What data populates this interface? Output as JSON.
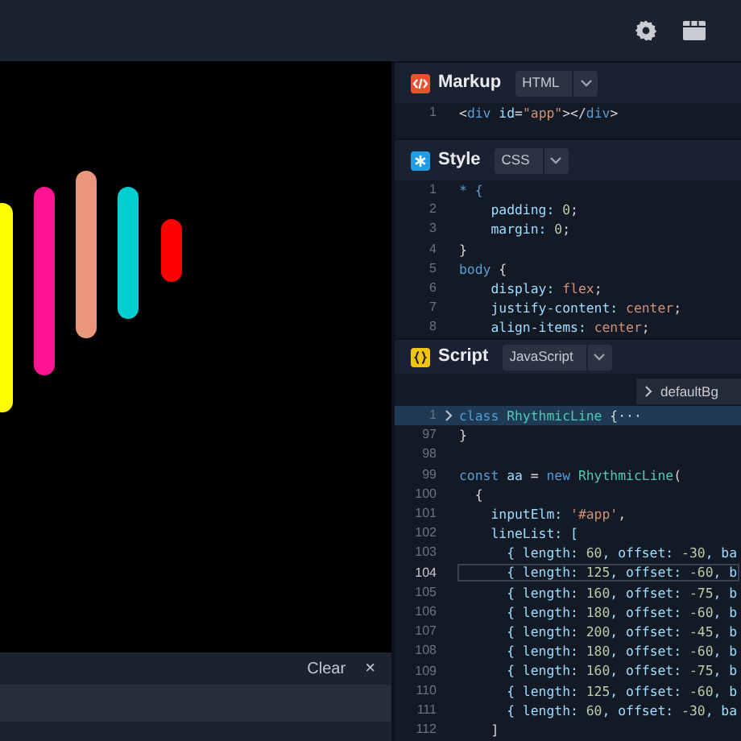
{
  "preview": {
    "bars": [
      {
        "color": "#ffff00"
      },
      {
        "color": "#ff1493"
      },
      {
        "color": "#e9967a"
      },
      {
        "color": "#00ced1"
      },
      {
        "color": "#ff0000"
      }
    ]
  },
  "console": {
    "clear_label": "Clear",
    "close_label": "×"
  },
  "panels": [
    {
      "kind": "markup",
      "title": "Markup",
      "language": "HTML",
      "lines": [
        {
          "n": "1",
          "tokens": [
            {
              "text": "<",
              "kind": "punct"
            },
            {
              "text": "div",
              "kind": "keyword"
            },
            {
              "text": " id",
              "kind": "property"
            },
            {
              "text": "=",
              "kind": "punct"
            },
            {
              "text": "\"app\"",
              "kind": "string"
            },
            {
              "text": "></",
              "kind": "punct"
            },
            {
              "text": "div",
              "kind": "keyword"
            },
            {
              "text": ">",
              "kind": "punct"
            }
          ]
        }
      ]
    },
    {
      "kind": "style",
      "title": "Style",
      "language": "CSS",
      "lines": [
        {
          "n": "1",
          "tokens": [
            {
              "text": "* {",
              "kind": "keyword"
            }
          ]
        },
        {
          "n": "2",
          "tokens": [
            {
              "text": "    padding: ",
              "kind": "property"
            },
            {
              "text": "0",
              "kind": "number"
            },
            {
              "text": ";",
              "kind": "punct"
            }
          ]
        },
        {
          "n": "3",
          "tokens": [
            {
              "text": "    margin: ",
              "kind": "property"
            },
            {
              "text": "0",
              "kind": "number"
            },
            {
              "text": ";",
              "kind": "punct"
            }
          ]
        },
        {
          "n": "4",
          "tokens": [
            {
              "text": "}",
              "kind": "punct"
            }
          ]
        },
        {
          "n": "5",
          "tokens": [
            {
              "text": "body",
              "kind": "keyword"
            },
            {
              "text": " {",
              "kind": "punct"
            }
          ]
        },
        {
          "n": "6",
          "tokens": [
            {
              "text": "    display: ",
              "kind": "property"
            },
            {
              "text": "flex",
              "kind": "string"
            },
            {
              "text": ";",
              "kind": "punct"
            }
          ]
        },
        {
          "n": "7",
          "tokens": [
            {
              "text": "    justify-content: ",
              "kind": "property"
            },
            {
              "text": "center",
              "kind": "string"
            },
            {
              "text": ";",
              "kind": "punct"
            }
          ]
        },
        {
          "n": "8",
          "tokens": [
            {
              "text": "    align-items: ",
              "kind": "property"
            },
            {
              "text": "center",
              "kind": "string"
            },
            {
              "text": ";",
              "kind": "punct"
            }
          ]
        }
      ]
    },
    {
      "kind": "script",
      "title": "Script",
      "language": "JavaScript",
      "breadcrumb": "defaultBg",
      "lines": [
        {
          "n": "1",
          "folded": true,
          "tokens": [
            {
              "text": "class ",
              "kind": "keyword"
            },
            {
              "text": "RhythmicLine",
              "kind": "class"
            },
            {
              "text": " {",
              "kind": "punct"
            },
            {
              "text": "···",
              "kind": "punct"
            }
          ]
        },
        {
          "n": "97",
          "tokens": [
            {
              "text": "}",
              "kind": "punct"
            }
          ]
        },
        {
          "n": "98"
        },
        {
          "n": "99",
          "tokens": [
            {
              "text": "const ",
              "kind": "keyword"
            },
            {
              "text": "aa ",
              "kind": "property"
            },
            {
              "text": "= ",
              "kind": "punct"
            },
            {
              "text": "new ",
              "kind": "keyword"
            },
            {
              "text": "RhythmicLine",
              "kind": "class"
            },
            {
              "text": "(",
              "kind": "punct"
            }
          ]
        },
        {
          "n": "100",
          "tokens": [
            {
              "text": "  {",
              "kind": "punct"
            }
          ]
        },
        {
          "n": "101",
          "tokens": [
            {
              "text": "    inputElm: ",
              "kind": "property"
            },
            {
              "text": "'#app'",
              "kind": "string"
            },
            {
              "text": ",",
              "kind": "punct"
            }
          ]
        },
        {
          "n": "102",
          "tokens": [
            {
              "text": "    lineList: [",
              "kind": "property"
            }
          ]
        },
        {
          "n": "103",
          "tokens": [
            {
              "text": "      { length: ",
              "kind": "property"
            },
            {
              "text": "60",
              "kind": "number"
            },
            {
              "text": ", offset: ",
              "kind": "property"
            },
            {
              "text": "-30",
              "kind": "number"
            },
            {
              "text": ", ba",
              "kind": "property"
            }
          ]
        },
        {
          "n": "104",
          "current": true,
          "tokens": [
            {
              "text": "      { length: ",
              "kind": "property"
            },
            {
              "text": "125",
              "kind": "number"
            },
            {
              "text": ", offset: ",
              "kind": "property"
            },
            {
              "text": "-60",
              "kind": "number"
            },
            {
              "text": ", b",
              "kind": "property"
            }
          ]
        },
        {
          "n": "105",
          "tokens": [
            {
              "text": "      { length: ",
              "kind": "property"
            },
            {
              "text": "160",
              "kind": "number"
            },
            {
              "text": ", offset: ",
              "kind": "property"
            },
            {
              "text": "-75",
              "kind": "number"
            },
            {
              "text": ", b",
              "kind": "property"
            }
          ]
        },
        {
          "n": "106",
          "tokens": [
            {
              "text": "      { length: ",
              "kind": "property"
            },
            {
              "text": "180",
              "kind": "number"
            },
            {
              "text": ", offset: ",
              "kind": "property"
            },
            {
              "text": "-60",
              "kind": "number"
            },
            {
              "text": ", b",
              "kind": "property"
            }
          ]
        },
        {
          "n": "107",
          "tokens": [
            {
              "text": "      { length: ",
              "kind": "property"
            },
            {
              "text": "200",
              "kind": "number"
            },
            {
              "text": ", offset: ",
              "kind": "property"
            },
            {
              "text": "-45",
              "kind": "number"
            },
            {
              "text": ", b",
              "kind": "property"
            }
          ]
        },
        {
          "n": "108",
          "tokens": [
            {
              "text": "      { length: ",
              "kind": "property"
            },
            {
              "text": "180",
              "kind": "number"
            },
            {
              "text": ", offset: ",
              "kind": "property"
            },
            {
              "text": "-60",
              "kind": "number"
            },
            {
              "text": ", b",
              "kind": "property"
            }
          ]
        },
        {
          "n": "109",
          "tokens": [
            {
              "text": "      { length: ",
              "kind": "property"
            },
            {
              "text": "160",
              "kind": "number"
            },
            {
              "text": ", offset: ",
              "kind": "property"
            },
            {
              "text": "-75",
              "kind": "number"
            },
            {
              "text": ", b",
              "kind": "property"
            }
          ]
        },
        {
          "n": "110",
          "tokens": [
            {
              "text": "      { length: ",
              "kind": "property"
            },
            {
              "text": "125",
              "kind": "number"
            },
            {
              "text": ", offset: ",
              "kind": "property"
            },
            {
              "text": "-60",
              "kind": "number"
            },
            {
              "text": ", b",
              "kind": "property"
            }
          ]
        },
        {
          "n": "111",
          "tokens": [
            {
              "text": "      { length: ",
              "kind": "property"
            },
            {
              "text": "60",
              "kind": "number"
            },
            {
              "text": ", offset: ",
              "kind": "property"
            },
            {
              "text": "-30",
              "kind": "number"
            },
            {
              "text": ", ba",
              "kind": "property"
            }
          ]
        },
        {
          "n": "112",
          "tokens": [
            {
              "text": "    ]",
              "kind": "punct"
            }
          ]
        }
      ]
    }
  ]
}
